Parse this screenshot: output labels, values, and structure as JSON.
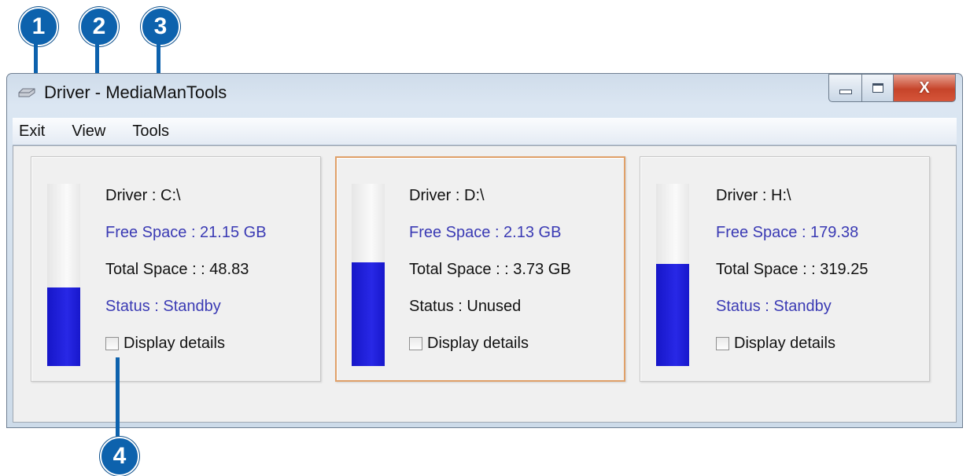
{
  "window": {
    "title": "Driver - MediaManTools",
    "close_glyph": "X"
  },
  "menu": {
    "items": [
      {
        "label": "Exit"
      },
      {
        "label": "View"
      },
      {
        "label": "Tools"
      }
    ]
  },
  "callouts": [
    "1",
    "2",
    "3",
    "4"
  ],
  "drives": [
    {
      "driver": "Driver : C:\\",
      "free": "Free Space : 21.15 GB",
      "total": "Total Space : : 48.83",
      "status": "Status : Standby",
      "details_label": "Display details",
      "usage_fraction": 0.43,
      "selected": false
    },
    {
      "driver": "Driver : D:\\",
      "free": "Free Space : 2.13 GB",
      "total": "Total Space : : 3.73 GB",
      "status": "Status : Unused",
      "details_label": "Display details",
      "usage_fraction": 0.57,
      "selected": true
    },
    {
      "driver": "Driver : H:\\",
      "free": "Free Space : 179.38",
      "total": "Total Space : : 319.25",
      "status": "Status : Standby",
      "details_label": "Display details",
      "usage_fraction": 0.56,
      "selected": false
    }
  ],
  "colors": {
    "callout": "#0d62ad",
    "bar_fill": "#1c1cd8",
    "blue_text": "#3a3ab4",
    "selected_border": "#e0a068"
  }
}
